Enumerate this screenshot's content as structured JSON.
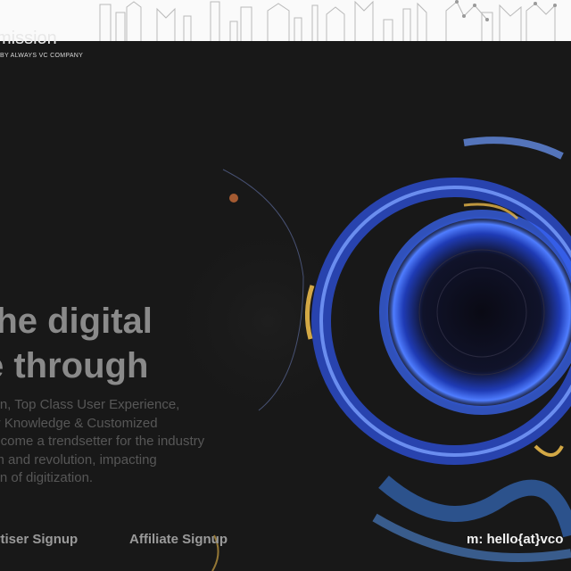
{
  "header": {
    "logo_word": "mission",
    "logo_tagline": "BY ALWAYS VC COMPANY"
  },
  "hero": {
    "headline_line1": "the digital",
    "headline_line2": "e through",
    "paragraph_lines": [
      "tion, Top Class User Experience,",
      "try Knowledge & Customized",
      "become a trendsetter for the industry",
      "om and revolution, impacting",
      "tion of digitization."
    ]
  },
  "footer": {
    "advertiser_signup": "vertiser Signup",
    "affiliate_signup": "Affiliate Signup",
    "contact": "m: hello{at}vco"
  },
  "colors": {
    "background": "#181818",
    "accent_blue": "#3b6cff",
    "accent_gold": "#e8b84a"
  }
}
